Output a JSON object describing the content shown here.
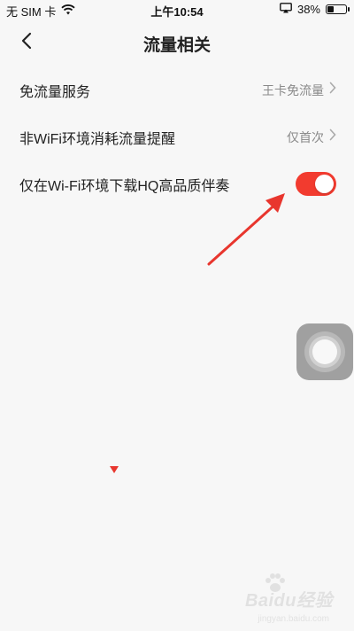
{
  "status_bar": {
    "carrier": "无 SIM 卡",
    "time": "上午10:54",
    "battery_percent_label": "38%",
    "battery_level": 0.38
  },
  "header": {
    "title": "流量相关"
  },
  "settings": [
    {
      "label": "免流量服务",
      "value": "王卡免流量"
    },
    {
      "label": "非WiFi环境消耗流量提醒",
      "value": "仅首次"
    },
    {
      "label": "仅在Wi-Fi环境下载HQ高品质伴奏",
      "toggle_on": true
    }
  ],
  "colors": {
    "accent": "#f23b2f",
    "background": "#f7f7f7"
  },
  "watermark": {
    "text": "Baidu经验",
    "sub": "jingyan.baidu.com"
  }
}
